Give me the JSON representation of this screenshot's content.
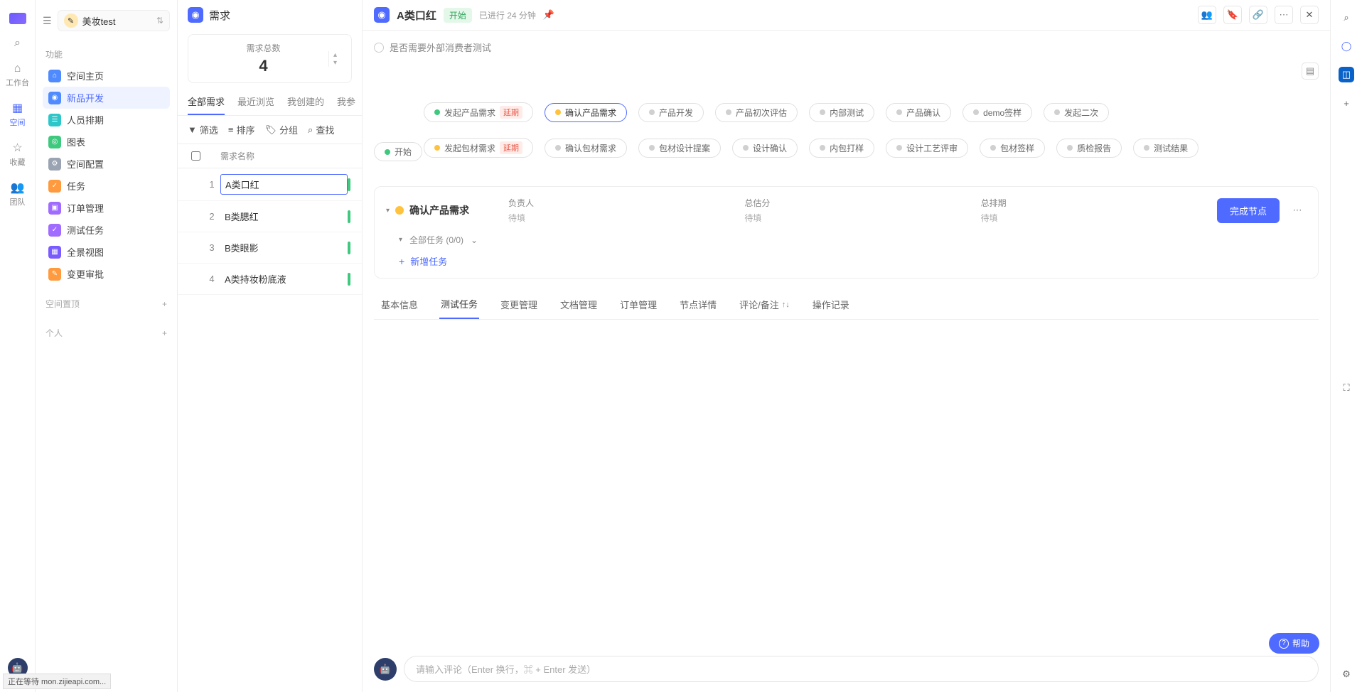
{
  "rail": {
    "search": "⌕",
    "items": [
      {
        "icon": "⌂",
        "label": "工作台"
      },
      {
        "icon": "▦",
        "label": "空间"
      },
      {
        "icon": "★",
        "label": "收藏"
      },
      {
        "icon": "👥",
        "label": "团队"
      }
    ]
  },
  "workspace": {
    "name": "美妆test"
  },
  "sidebar": {
    "section_function": "功能",
    "nav": [
      {
        "label": "空间主页",
        "color": "ic-blue",
        "glyph": "⌂"
      },
      {
        "label": "新品开发",
        "color": "ic-blue",
        "glyph": "◉"
      },
      {
        "label": "人员排期",
        "color": "ic-teal",
        "glyph": "☰"
      },
      {
        "label": "图表",
        "color": "ic-green",
        "glyph": "◎"
      },
      {
        "label": "空间配置",
        "color": "ic-gray",
        "glyph": "⚙"
      },
      {
        "label": "任务",
        "color": "ic-orange",
        "glyph": "✓"
      },
      {
        "label": "订单管理",
        "color": "ic-violet",
        "glyph": "▣"
      },
      {
        "label": "测试任务",
        "color": "ic-violet",
        "glyph": "✓"
      },
      {
        "label": "全景视图",
        "color": "ic-purple",
        "glyph": "▦"
      },
      {
        "label": "变更审批",
        "color": "ic-orange",
        "glyph": "✎"
      }
    ],
    "group_pinned": "空间置顶",
    "group_personal": "个人"
  },
  "list": {
    "title": "需求",
    "stat_label": "需求总数",
    "stat_value": "4",
    "tabs": [
      "全部需求",
      "最近浏览",
      "我创建的",
      "我参"
    ],
    "toolbar": {
      "filter": "筛选",
      "sort": "排序",
      "group": "分组",
      "search": "查找"
    },
    "header_name": "需求名称",
    "rows": [
      {
        "idx": "1",
        "name": "A类口红"
      },
      {
        "idx": "2",
        "name": "B类腮红"
      },
      {
        "idx": "3",
        "name": "B类眼影"
      },
      {
        "idx": "4",
        "name": "A类持妆粉底液"
      }
    ]
  },
  "detail": {
    "title": "A类口红",
    "status": "开始",
    "elapsed": "已进行 24 分钟",
    "checkbox_label": "是否需要外部消费者测试",
    "flow": {
      "start": "开始",
      "delay_label": "延期",
      "row1": [
        "发起产品需求",
        "确认产品需求",
        "产品开发",
        "产品初次评估",
        "内部测试",
        "产品确认",
        "demo签样",
        "发起二次"
      ],
      "row2": [
        "发起包材需求",
        "确认包材需求",
        "包材设计提案",
        "设计确认",
        "内包打样",
        "设计工艺评审",
        "包材签样",
        "质检报告",
        "测试结果"
      ]
    },
    "node_card": {
      "name": "确认产品需求",
      "owner_label": "负责人",
      "owner_value": "待填",
      "est_label": "总估分",
      "est_value": "待填",
      "sched_label": "总排期",
      "sched_value": "待填",
      "complete_btn": "完成节点",
      "subtasks": "全部任务 (0/0)",
      "add_task": "新增任务"
    },
    "bottom_tabs": [
      "基本信息",
      "测试任务",
      "变更管理",
      "文档管理",
      "订单管理",
      "节点详情",
      "评论/备注",
      "操作记录"
    ],
    "comment_placeholder": "请输入评论（Enter 换行，⌘ + Enter 发送）"
  },
  "help_label": "帮助",
  "browser_status": "正在等待 mon.zijieapi.com..."
}
